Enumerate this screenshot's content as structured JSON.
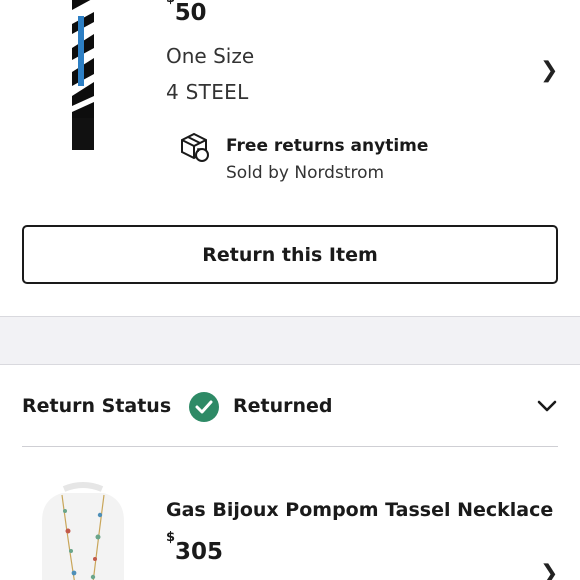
{
  "item1": {
    "price_symbol": "$",
    "price_value": "50",
    "size": "One Size",
    "color": "4 STEEL",
    "returns_title": "Free returns anytime",
    "sold_by": "Sold by Nordstrom",
    "return_button_label": "Return this Item"
  },
  "status": {
    "label": "Return Status",
    "value": "Returned",
    "badge_color": "#2e8a66"
  },
  "item2": {
    "name": "Gas Bijoux Pompom Tassel Necklace",
    "price_symbol": "$",
    "price_value": "305"
  },
  "icons": [
    "chevron-right-icon",
    "returns-box-icon",
    "check-icon",
    "chevron-down-icon"
  ]
}
